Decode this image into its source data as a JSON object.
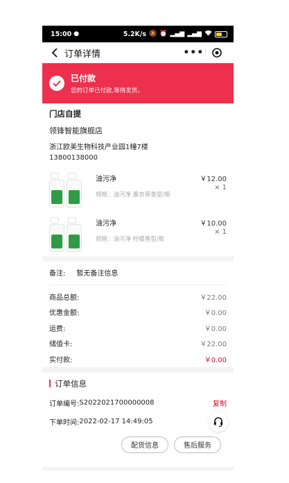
{
  "status_bar": {
    "time": "15:00",
    "speed": "5.2K/s",
    "battery": "16"
  },
  "nav": {
    "title": "订单详情",
    "more": "•••"
  },
  "banner": {
    "status": "已付款",
    "message": "您的订单已付款,等待发货。"
  },
  "store": {
    "method": "门店自提",
    "name": "领锋智能旗舰店",
    "address": "浙江欧美生物科技产业园1幢7楼",
    "phone": "13800138000"
  },
  "items": [
    {
      "name": "油污净",
      "spec": "规格：油污净 薰衣草香型/瓶",
      "price": "￥12.00",
      "qty": "× 1"
    },
    {
      "name": "油污净",
      "spec": "规格：油污净 柠檬香型/瓶",
      "price": "￥10.00",
      "qty": "× 1"
    }
  ],
  "remark": {
    "label": "备注:",
    "value": "暂无备注信息"
  },
  "fees": [
    {
      "label": "商品总额:",
      "value": "￥22.00"
    },
    {
      "label": "优惠金额:",
      "value": "￥0.00"
    },
    {
      "label": "运费:",
      "value": "￥0.00"
    },
    {
      "label": "储值卡:",
      "value": "￥22.00"
    },
    {
      "label": "实付款:",
      "value": "￥0.00"
    }
  ],
  "order_info": {
    "title": "订单信息",
    "number_label": "订单编号:",
    "number": "S2022021700000008",
    "copy_label": "复制",
    "time_label": "下单时间:",
    "time": "2022-02-17 14:49:05"
  },
  "actions": {
    "delivery_info": "配货信息",
    "after_sales": "售后服务"
  },
  "colors": {
    "accent": "#ee2f4d",
    "price_red": "#c8102e"
  }
}
